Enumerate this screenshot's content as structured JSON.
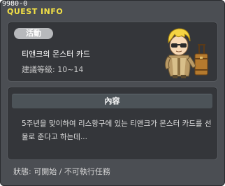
{
  "window": {
    "quest_id": "9980-0",
    "title": "QUEST INFO"
  },
  "summary": {
    "badge": "活動",
    "quest_name": "티앤크의 몬스터 카드",
    "required_level": "建議等級: 10~14",
    "npc_image": "npc-character-with-suitcase"
  },
  "detail": {
    "header": "內容",
    "description": "5주년을 맞이하여 리스항구에 있는 티앤크가 몬스터 카드를 선물로 준다고 하는데..."
  },
  "footer": {
    "status": "狀態:  可開始  /  不可執行任務"
  },
  "colors": {
    "window_bg": "#4b4e53",
    "panel_bg": "#34363a",
    "title": "#f2e046",
    "badge_bg": "#b7b9bc"
  }
}
